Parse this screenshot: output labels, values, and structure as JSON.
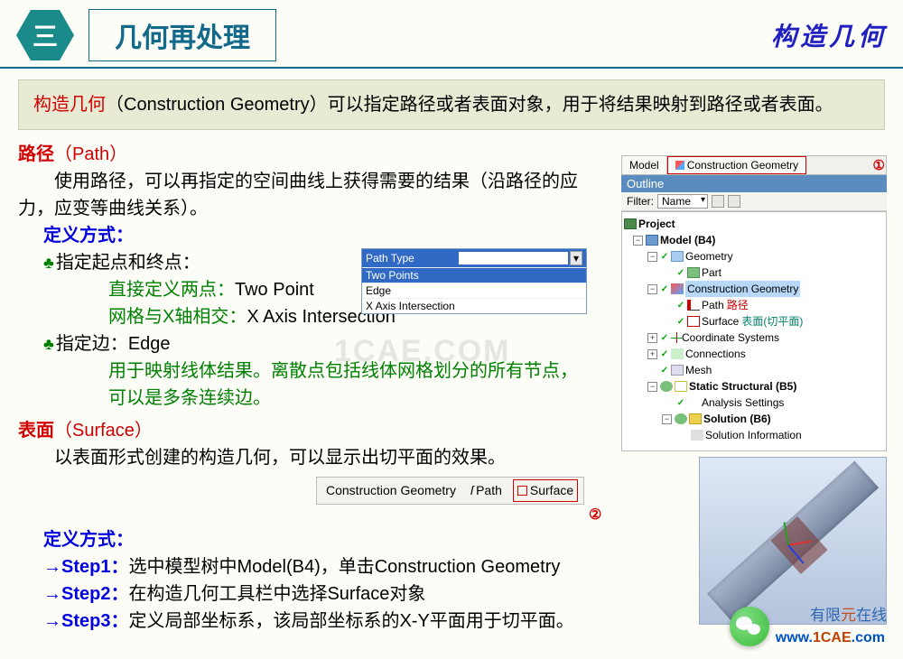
{
  "header": {
    "num": "三",
    "title": "几何再处理",
    "right": "构造几何"
  },
  "desc": {
    "t1": "构造几何",
    "t2": "（Construction Geometry）可以指定路径或者表面对象，用于将结果映射到路径或者表面。"
  },
  "path": {
    "h": "路径",
    "hp": "（Path）",
    "p1": "使用路径，可以再指定的空间曲线上获得需要的结果（沿路径的应力，应变等曲线关系）。",
    "def": "定义方式：",
    "b1": "指定起点和终点：",
    "b1a": "直接定义两点：",
    "b1a2": "Two Point",
    "b1b": "网格与X轴相交：",
    "b1b2": "X Axis Intersection",
    "b2a": "指定边：",
    "b2b": "Edge",
    "b2c": "用于映射线体结果。离散点包括线体网格划分的所有节点，可以是多条连续边。"
  },
  "surface": {
    "h": "表面",
    "hp": "（Surface）",
    "p1": "以表面形式创建的构造几何，可以显示出切平面的效果。",
    "def": "定义方式：",
    "s1a": "→Step1：",
    "s1b": "选中模型树中Model(B4)，单击Construction Geometry",
    "s2a": "→Step2：",
    "s2b": "在构造几何工具栏中选择Surface对象",
    "s3a": "→Step3：",
    "s3b": "定义局部坐标系，该局部坐标系的X-Y平面用于切平面。"
  },
  "dropdown": {
    "label": "Path Type",
    "o1": "Two Points",
    "o2": "Edge",
    "o3": "X Axis Intersection"
  },
  "tb2": {
    "cg": "Construction Geometry",
    "path": "Path",
    "surf": "Surface",
    "n": "②"
  },
  "tabs": {
    "m": "Model",
    "cg": "Construction Geometry",
    "n": "①"
  },
  "outline": {
    "title": "Outline",
    "filter": "Filter:",
    "name": "Name"
  },
  "tree": {
    "proj": "Project",
    "model": "Model (B4)",
    "geo": "Geometry",
    "part": "Part",
    "cg": "Construction Geometry",
    "path": "Path",
    "path_r": "路径",
    "surf": "Surface",
    "surf_r": "表面(切平面)",
    "cs": "Coordinate Systems",
    "conn": "Connections",
    "mesh": "Mesh",
    "ss": "Static Structural (B5)",
    "as": "Analysis Settings",
    "sol": "Solution (B6)",
    "si": "Solution Information"
  },
  "wm": "1CAE.COM",
  "footer": {
    "a": "有限",
    "b": "元",
    "c": "在线",
    "u1": "www.",
    "u2": "1CAE",
    "u3": ".com"
  }
}
